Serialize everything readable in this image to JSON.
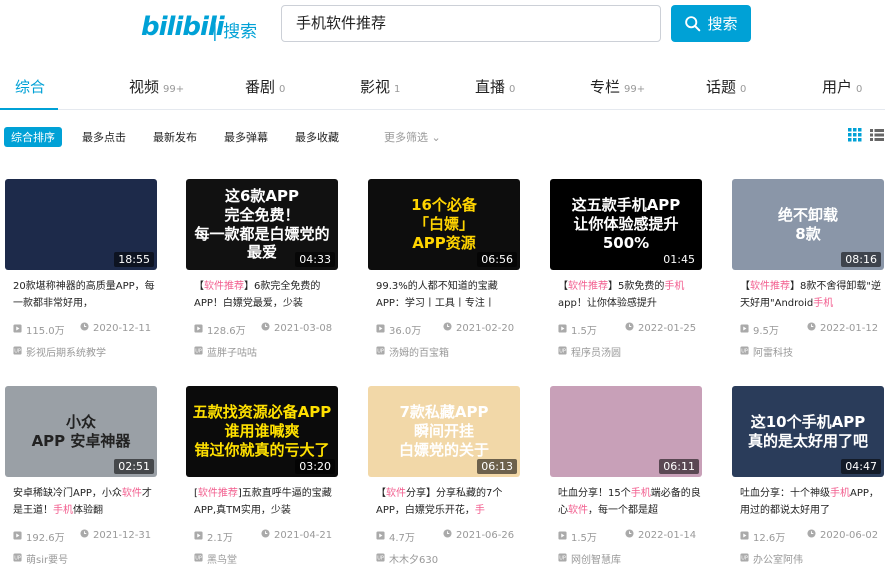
{
  "header": {
    "logo": "bilibili",
    "logo_suffix": "| 搜索",
    "search_value": "手机软件推荐",
    "search_button": "搜索"
  },
  "tabs": [
    {
      "label": "综合",
      "count": ""
    },
    {
      "label": "视频",
      "count": "99+"
    },
    {
      "label": "番剧",
      "count": "0"
    },
    {
      "label": "影视",
      "count": "1"
    },
    {
      "label": "直播",
      "count": "0"
    },
    {
      "label": "专栏",
      "count": "99+"
    },
    {
      "label": "话题",
      "count": "0"
    },
    {
      "label": "用户",
      "count": "0"
    }
  ],
  "filters": [
    "综合排序",
    "最多点击",
    "最新发布",
    "最多弹幕",
    "最多收藏",
    "更多筛选"
  ],
  "videos": [
    {
      "thumb_text": "",
      "duration": "18:55",
      "title_parts": [
        [
          "20款堪称神器的高质量APP，每一款都非常好用，",
          false
        ]
      ],
      "plays": "115.0万",
      "date": "2020-12-11",
      "uploader": "影视后期系统教学",
      "bg": "#1d2a4a",
      "fg": "#ffffff"
    },
    {
      "thumb_text": "这6款APP\n完全免费！\n每一款都是白嫖党的最爱",
      "duration": "04:33",
      "title_parts": [
        [
          "【",
          false
        ],
        [
          "软件推荐",
          true
        ],
        [
          "】6款完全免费的APP！白嫖党最爱，少装",
          false
        ]
      ],
      "plays": "128.6万",
      "date": "2021-03-08",
      "uploader": "蓝胖子咕咕",
      "bg": "#111111",
      "fg": "#ffffff"
    },
    {
      "thumb_text": "16个必备\n「白嫖」\nAPP资源",
      "duration": "06:56",
      "title_parts": [
        [
          "99.3%的人都不知道的宝藏APP：学习丨工具丨专注丨",
          false
        ]
      ],
      "plays": "36.0万",
      "date": "2021-02-20",
      "uploader": "汤姆的百宝箱",
      "bg": "#0d0d0d",
      "fg": "#ffd400"
    },
    {
      "thumb_text": "这五款手机APP\n让你体验感提升500%",
      "duration": "01:45",
      "title_parts": [
        [
          "【",
          false
        ],
        [
          "软件推荐",
          true
        ],
        [
          "】5款免费的",
          false
        ],
        [
          "手",
          true
        ],
        [
          "机",
          true
        ],
        [
          "app！让你体验感提升",
          false
        ]
      ],
      "plays": "1.5万",
      "date": "2022-01-25",
      "uploader": "程序员汤圆",
      "bg": "#000000",
      "fg": "#ffffff"
    },
    {
      "thumb_text": "绝不卸载\n8款",
      "duration": "08:16",
      "title_parts": [
        [
          "【",
          false
        ],
        [
          "软件推荐",
          true
        ],
        [
          "】8款不舍得卸载\"逆天好用\"Android",
          false
        ],
        [
          "手机",
          true
        ]
      ],
      "plays": "9.5万",
      "date": "2022-01-12",
      "uploader": "阿雷科技",
      "bg": "#8a96a8",
      "fg": "#ffffff"
    },
    {
      "thumb_text": "小众\nAPP   安卓神器",
      "duration": "02:51",
      "title_parts": [
        [
          "安卓稀缺冷门APP，小众",
          false
        ],
        [
          "软件",
          true
        ],
        [
          "才是王道！",
          false
        ],
        [
          "手机",
          true
        ],
        [
          "体验翻",
          false
        ]
      ],
      "plays": "192.6万",
      "date": "2021-12-31",
      "uploader": "萌sir要号",
      "bg": "#9aa0a6",
      "fg": "#222222"
    },
    {
      "thumb_text": "五款找资源必备APP\n谁用谁喊爽\n错过你就真的亏大了",
      "duration": "03:20",
      "title_parts": [
        [
          "[",
          false
        ],
        [
          "软件推荐",
          true
        ],
        [
          "]五款直呼牛逼的宝藏APP,真TM实用，少装",
          false
        ]
      ],
      "plays": "2.1万",
      "date": "2021-04-21",
      "uploader": "黑鸟堂",
      "bg": "#0b0b0b",
      "fg": "#ffe000"
    },
    {
      "thumb_text": "7款私藏APP\n瞬间开挂\n白嫖党的关于",
      "duration": "06:13",
      "title_parts": [
        [
          "【",
          false
        ],
        [
          "软件",
          true
        ],
        [
          "分享】分享私藏的7个APP，白嫖党乐开花，",
          false
        ],
        [
          "手",
          true
        ]
      ],
      "plays": "4.7万",
      "date": "2021-06-26",
      "uploader": "木木夕630",
      "bg": "#f2d8a8",
      "fg": "#ffffff"
    },
    {
      "thumb_text": "",
      "duration": "06:11",
      "title_parts": [
        [
          "吐血分享！15个",
          false
        ],
        [
          "手机",
          true
        ],
        [
          "端必备的良心",
          false
        ],
        [
          "软件",
          true
        ],
        [
          "，每一个都是超",
          false
        ]
      ],
      "plays": "1.5万",
      "date": "2022-01-14",
      "uploader": "网创智慧库",
      "bg": "#c8a0b8",
      "fg": "#ffffff"
    },
    {
      "thumb_text": "这10个手机APP\n真的是太好用了吧",
      "duration": "04:47",
      "title_parts": [
        [
          "吐血分享：十个神级",
          false
        ],
        [
          "手机",
          true
        ],
        [
          "APP，用过的都说太好用了",
          false
        ]
      ],
      "plays": "12.6万",
      "date": "2020-06-02",
      "uploader": "办公室阿伟",
      "bg": "#2a3c5a",
      "fg": "#ffffff"
    }
  ],
  "colors": {
    "accent": "#00a1d6",
    "highlight": "#f25d8e",
    "muted": "#999999"
  }
}
